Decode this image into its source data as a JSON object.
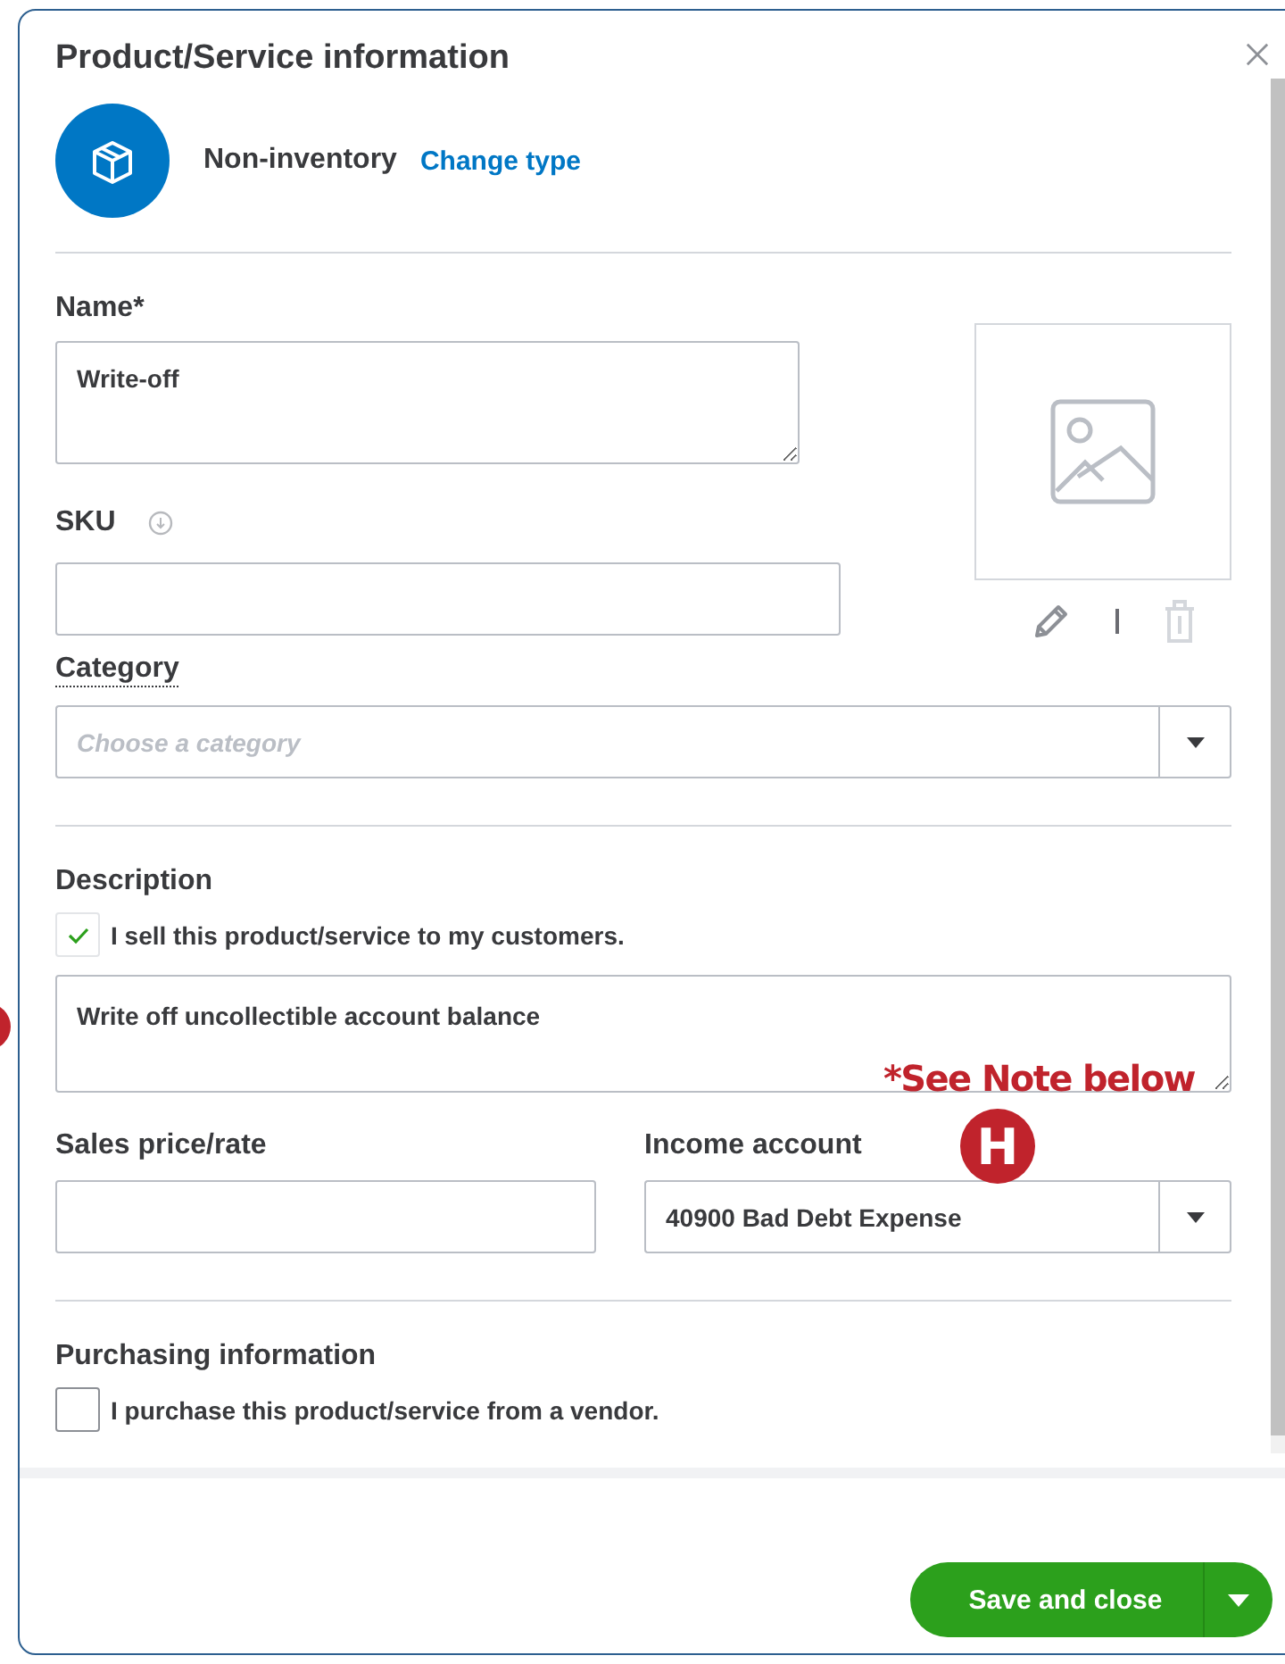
{
  "dialog": {
    "title": "Product/Service information",
    "type_label": "Non-inventory",
    "change_type_link": "Change type"
  },
  "name": {
    "label": "Name*",
    "value": "Write-off"
  },
  "sku": {
    "label": "SKU"
  },
  "category": {
    "label": "Category",
    "placeholder": "Choose a category"
  },
  "description": {
    "label": "Description",
    "sell_checkbox": {
      "label": "I sell this product/service to my customers.",
      "checked": true
    },
    "value": "Write off uncollectible account balance"
  },
  "sales_price": {
    "label": "Sales price/rate"
  },
  "income_account": {
    "label": "Income account",
    "value": "40900 Bad Debt Expense"
  },
  "purchasing": {
    "label": "Purchasing information",
    "checkbox": {
      "label": "I purchase this product/service from a vendor.",
      "checked": false
    }
  },
  "annotations": {
    "note": "*See Note below",
    "marker": "H"
  },
  "footer": {
    "save_button": "Save and close"
  }
}
